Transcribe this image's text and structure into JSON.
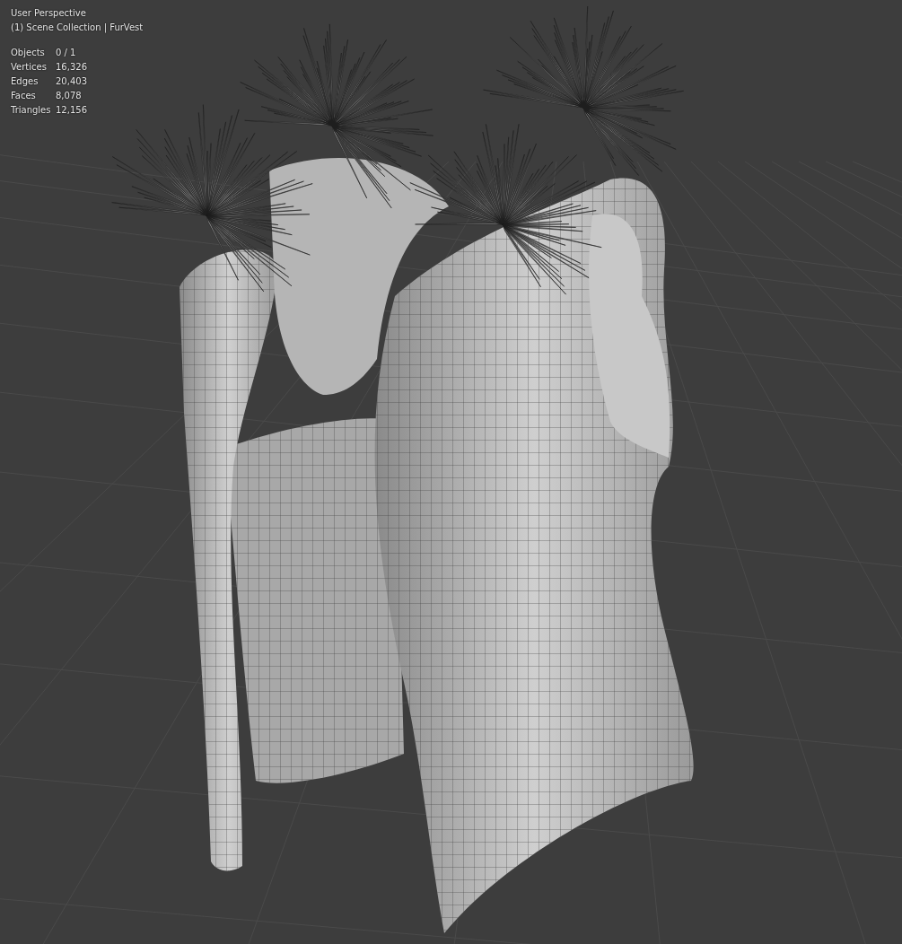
{
  "viewport": {
    "view_name": "User Perspective",
    "context": "(1) Scene Collection | FurVest",
    "statistics": [
      {
        "label": "Objects",
        "value": "0 / 1"
      },
      {
        "label": "Vertices",
        "value": "16,326"
      },
      {
        "label": "Edges",
        "value": "20,403"
      },
      {
        "label": "Faces",
        "value": "8,078"
      },
      {
        "label": "Triangles",
        "value": "12,156"
      }
    ]
  }
}
